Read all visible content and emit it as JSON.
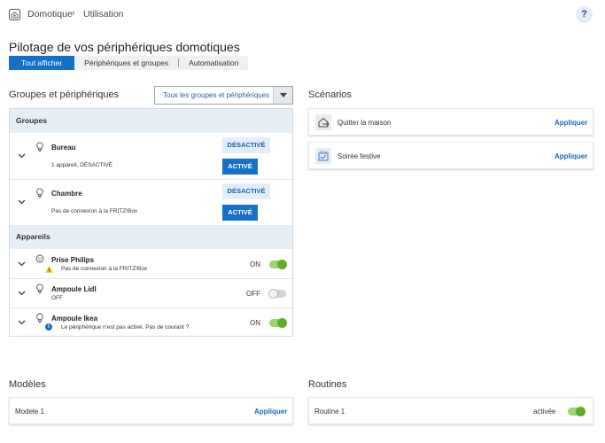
{
  "breadcrumb": {
    "root": "Domotique",
    "current": "Utilisation"
  },
  "help_label": "?",
  "page_title": "Pilotage de vos périphériques domotiques",
  "tabs": [
    {
      "label": "Tout afficher"
    },
    {
      "label": "Périphériques et groupes"
    },
    {
      "label": "Automatisation"
    }
  ],
  "devices_section": {
    "title": "Groupes et périphériques",
    "filter_value": "Tous les groupes et périphériques",
    "groups_header": "Groupes",
    "groups": [
      {
        "name": "Bureau",
        "status": "1 appareil, DÉSACTIVÉ",
        "off_label": "DÉSACTIVÉ",
        "on_label": "ACTIVÉ"
      },
      {
        "name": "Chambre",
        "status": "Pas de connexion à la FRITZ!Box",
        "off_label": "DÉSACTIVÉ",
        "on_label": "ACTIVÉ"
      }
    ],
    "devices_header": "Appareils",
    "devices": [
      {
        "name": "Prise Philips",
        "status": "Pas de connexion à la FRITZ!Box",
        "state": "ON",
        "icon": "warning-icon"
      },
      {
        "name": "Ampoule Lidl",
        "status": "OFF",
        "state": "OFF",
        "icon": "bulb-icon"
      },
      {
        "name": "Ampoule Ikea",
        "status": "Le périphérique n'est pas activé. Pas de courant ?",
        "state": "ON",
        "icon": "info-icon"
      }
    ]
  },
  "scenarios": {
    "title": "Scénarios",
    "items": [
      {
        "name": "Quitter la maison",
        "action": "Appliquer",
        "icon": "leave-home-icon"
      },
      {
        "name": "Soirée festive",
        "action": "Appliquer",
        "icon": "party-icon"
      }
    ]
  },
  "modeles": {
    "title": "Modèles",
    "items": [
      {
        "name": "Modele 1",
        "action": "Appliquer"
      }
    ]
  },
  "routines": {
    "title": "Routines",
    "items": [
      {
        "name": "Routine 1",
        "state": "activée"
      }
    ]
  },
  "colors": {
    "accent": "#1570c8",
    "toggle_on": "#5fae2a",
    "header_bg": "#e7eef6"
  }
}
